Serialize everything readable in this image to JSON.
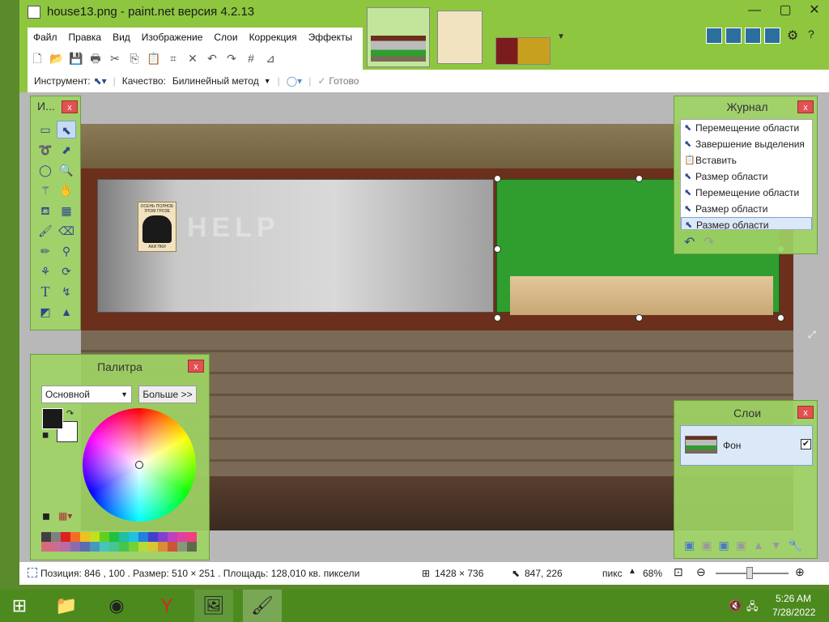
{
  "window": {
    "title": "house13.png - paint.net версия 4.2.13",
    "minimize": "—",
    "maximize": "▢",
    "close": "✕"
  },
  "menu": [
    "Файл",
    "Правка",
    "Вид",
    "Изображение",
    "Слои",
    "Коррекция",
    "Эффекты"
  ],
  "toolbar": {
    "tool_label": "Инструмент:",
    "quality_label": "Качество:",
    "quality_value": "Билинейный метод",
    "done_label": "Готово"
  },
  "tools_panel": {
    "title": "И...",
    "close": "x"
  },
  "history_panel": {
    "title": "Журнал",
    "close": "x",
    "items": [
      "Перемещение области",
      "Завершение выделения",
      "Вставить",
      "Размер области",
      "Перемещение области",
      "Размер области",
      "Размер области"
    ],
    "selected_index": 6
  },
  "palette_panel": {
    "title": "Палитра",
    "close": "x",
    "mode": "Основной",
    "more_button": "Больше >>",
    "primary_color": "#1a1a1a",
    "secondary_color": "#ffffff",
    "swatches": [
      "#404040",
      "#808080",
      "#e02020",
      "#f07020",
      "#f0c020",
      "#c0e020",
      "#60d020",
      "#20c040",
      "#20c0a0",
      "#20c0e0",
      "#2080e0",
      "#4040d0",
      "#8040d0",
      "#c040c0",
      "#e040a0",
      "#f04080"
    ]
  },
  "layers_panel": {
    "title": "Слои",
    "close": "x",
    "layer_name": "Фон",
    "layer_visible": true
  },
  "canvas_text": {
    "poster_line1": "ОСЕНЬ ПОЛНОЕ",
    "poster_line2": "ЭТОМ ГРОЗЕ",
    "poster_line3": "АКИ  ПКИ",
    "wall_graffiti": "HELP"
  },
  "status": {
    "position_label": "Позиция: 846 , 100 . Размер: 510  × 251 . Площадь: 128,010 кв. пиксели",
    "image_size": "1428 × 736",
    "cursor_pos": "847, 226",
    "units": "пикс",
    "zoom": "68%"
  },
  "taskbar": {
    "time": "5:26 AM",
    "date": "7/28/2022"
  },
  "colors": {
    "chrome": "#8ec63f",
    "taskbar": "#4c8a1e",
    "panel": "#9ed264",
    "accent_red": "#e25050"
  }
}
